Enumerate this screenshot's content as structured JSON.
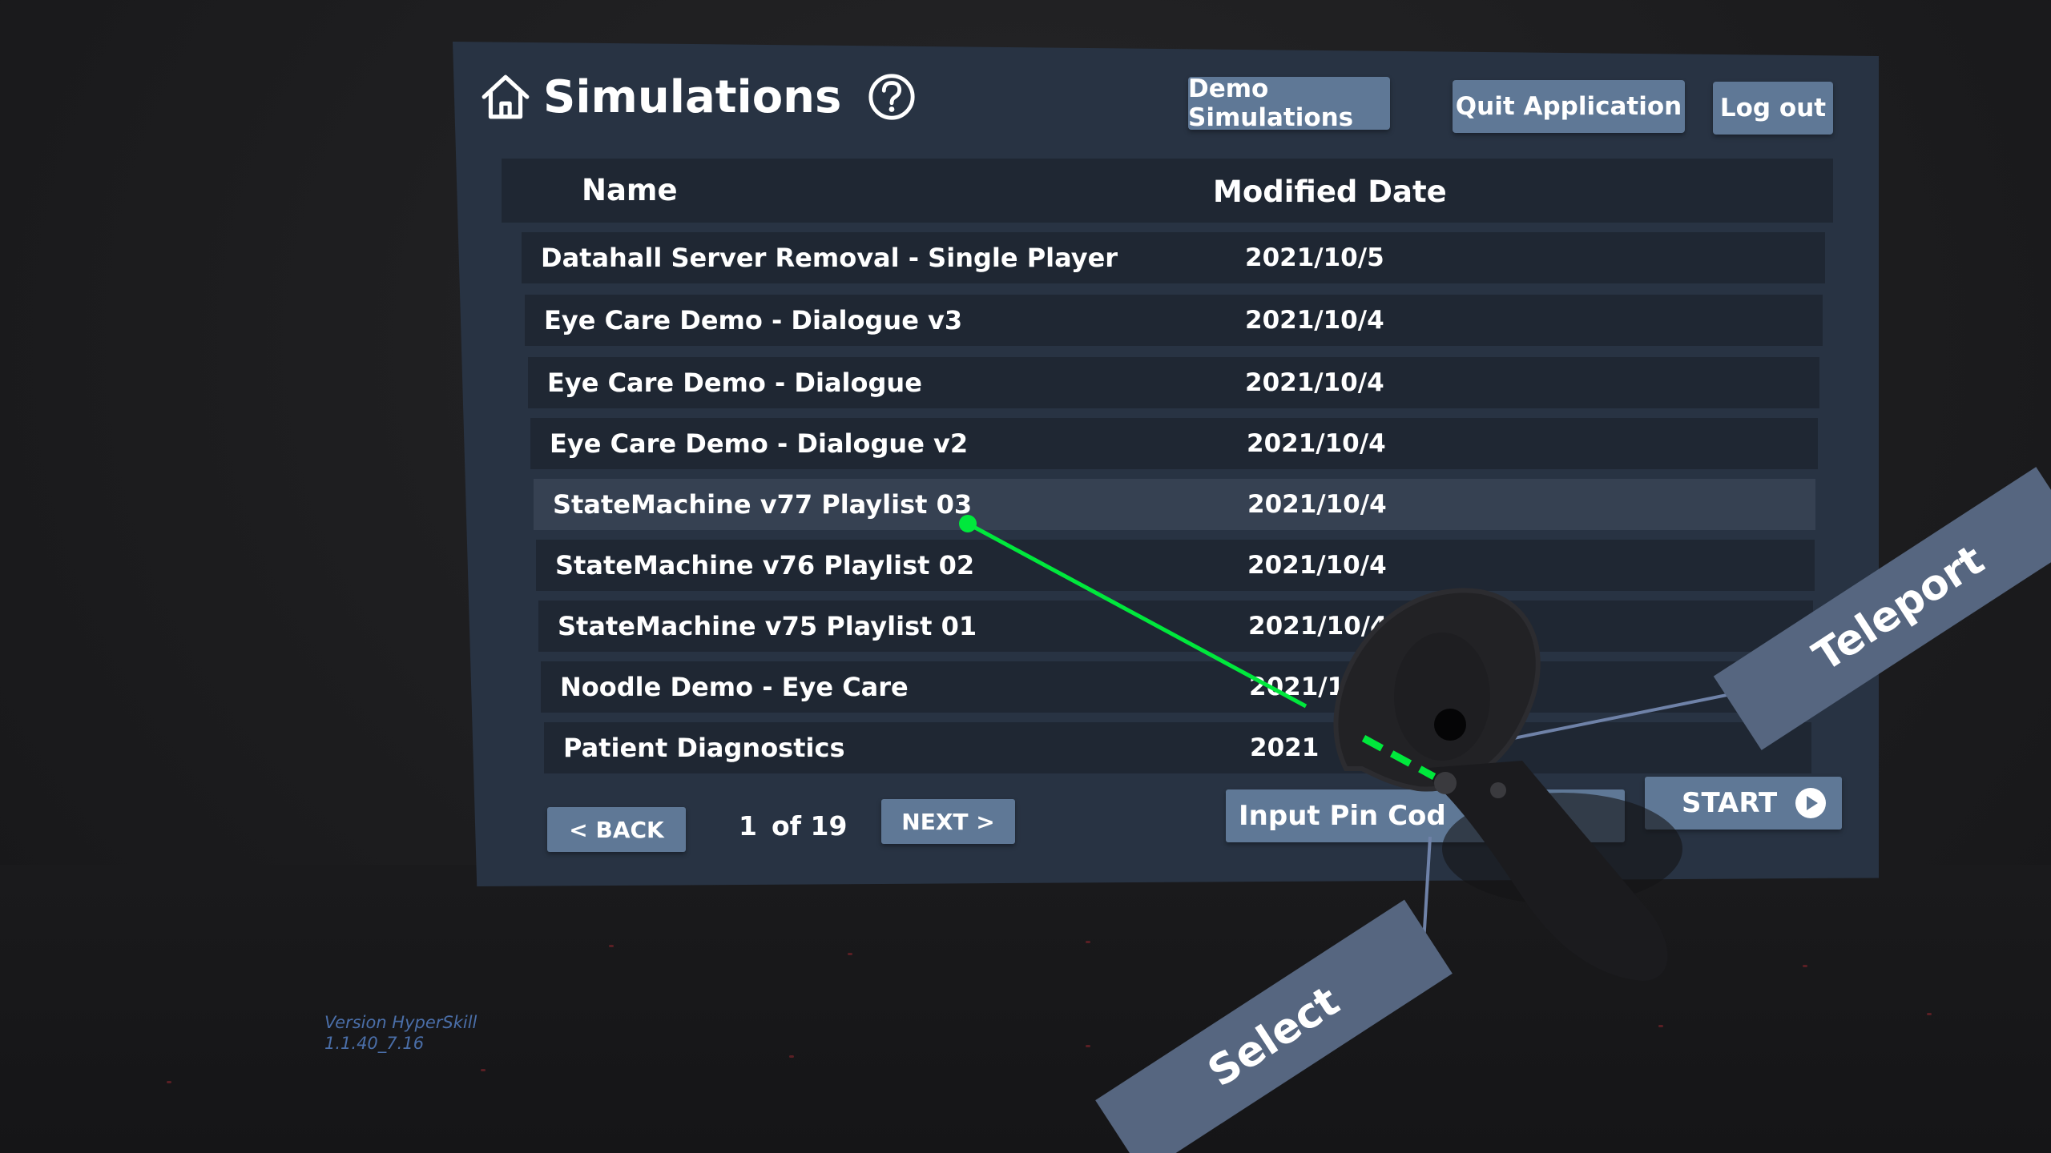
{
  "header": {
    "title": "Simulations",
    "home_icon": "home-icon",
    "help_icon": "help-icon",
    "buttons": {
      "demo": "Demo Simulations",
      "quit": "Quit Application",
      "logout": "Log out"
    }
  },
  "table": {
    "columns": {
      "name": "Name",
      "modified": "Modified Date"
    },
    "rows": [
      {
        "name": "Datahall Server Removal - Single Player",
        "date": "2021/10/5"
      },
      {
        "name": "Eye Care Demo - Dialogue v3",
        "date": "2021/10/4"
      },
      {
        "name": "Eye Care Demo - Dialogue",
        "date": "2021/10/4"
      },
      {
        "name": "Eye Care Demo - Dialogue v2",
        "date": "2021/10/4"
      },
      {
        "name": "StateMachine v77 Playlist 03",
        "date": "2021/10/4"
      },
      {
        "name": "StateMachine v76 Playlist 02",
        "date": "2021/10/4"
      },
      {
        "name": "StateMachine v75 Playlist 01",
        "date": "2021/10/4"
      },
      {
        "name": "Noodle Demo - Eye Care",
        "date": "2021/1"
      },
      {
        "name": "Patient Diagnostics",
        "date": "2021"
      }
    ],
    "highlighted_row": 4
  },
  "footer": {
    "back": "<  BACK",
    "page_current": "1",
    "page_of": "of 19",
    "next": "NEXT  >",
    "pin_button": "Input Pin Cod",
    "start_button": "START",
    "start_icon": "play-circle-icon"
  },
  "vr": {
    "teleport_label": "Teleport",
    "select_label": "Select",
    "version_line1": "Version HyperSkill",
    "version_line2": "1.1.40_7.16",
    "laser_color": "#00e83c"
  },
  "colors": {
    "panel": "#283343",
    "row": "#1f2733",
    "row_highlight": "#364152",
    "button": "#5f7896"
  }
}
